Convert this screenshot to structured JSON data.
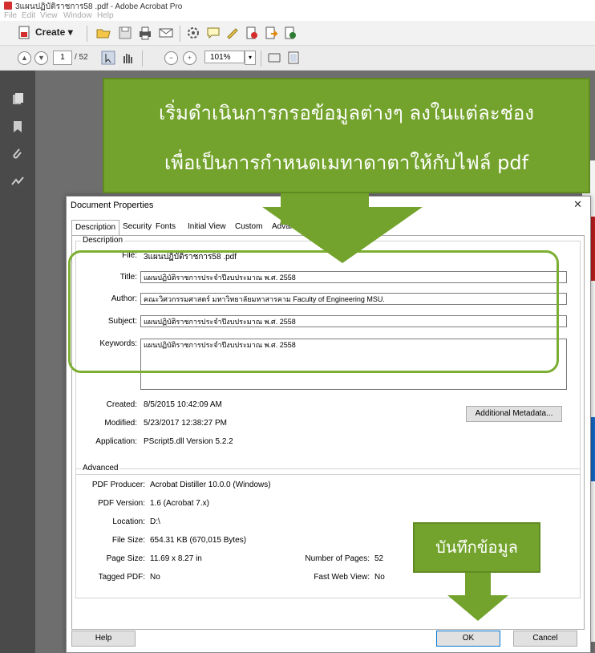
{
  "window": {
    "title": "3แผนปฏิบัติราชการ58 .pdf - Adobe Acrobat Pro"
  },
  "menu": [
    "File",
    "Edit",
    "View",
    "Window",
    "Help"
  ],
  "toolbar": {
    "create_label": "Create",
    "create_arrow": "▾"
  },
  "nav": {
    "page_current": "1",
    "page_total": "/ 52",
    "zoom": "101%",
    "zoom_arrow": "▾"
  },
  "callout": {
    "line1": "เริ่มดำเนินการกรอข้อมูลต่างๆ ลงในแต่ละช่อง",
    "line2": "เพื่อเป็นการกำหนดเมทาดาตาให้กับไฟล์ pdf",
    "save_label": "บันทึกข้อมูล",
    "color": "#73a32c"
  },
  "dialog": {
    "title": "Document Properties",
    "close_glyph": "✕",
    "tabs": [
      "Description",
      "Security",
      "Fonts",
      "Initial View",
      "Custom",
      "Advanced"
    ],
    "description": {
      "group_label": "Description",
      "file_label": "File:",
      "file_value": "3แผนปฏิบัติราชการ58 .pdf",
      "title_label": "Title:",
      "title_value": "แผนปฏิบัติราชการประจำปีงบประมาณ พ.ศ. 2558",
      "author_label": "Author:",
      "author_value": "คณะวิศวกรรมศาสตร์ มหาวิทยาลัยมหาสารคาม Faculty of Engineering MSU.",
      "subject_label": "Subject:",
      "subject_value": "แผนปฏิบัติราชการประจำปีงบประมาณ พ.ศ. 2558",
      "keywords_label": "Keywords:",
      "keywords_value": "แผนปฏิบัติราชการประจำปีงบประมาณ พ.ศ. 2558",
      "created_label": "Created:",
      "created_value": "8/5/2015 10:42:09 AM",
      "modified_label": "Modified:",
      "modified_value": "5/23/2017 12:38:27 PM",
      "application_label": "Application:",
      "application_value": "PScript5.dll Version 5.2.2",
      "additional_metadata_button": "Additional Metadata..."
    },
    "advanced": {
      "group_label": "Advanced",
      "producer_label": "PDF Producer:",
      "producer_value": "Acrobat Distiller 10.0.0 (Windows)",
      "version_label": "PDF Version:",
      "version_value": "1.6 (Acrobat 7.x)",
      "location_label": "Location:",
      "location_value": "D:\\",
      "filesize_label": "File Size:",
      "filesize_value": "654.31 KB (670,015 Bytes)",
      "pagesize_label": "Page Size:",
      "pagesize_value": "11.69 x 8.27 in",
      "numpages_label": "Number of Pages:",
      "numpages_value": "52",
      "tagged_label": "Tagged PDF:",
      "tagged_value": "No",
      "fastweb_label": "Fast Web View:",
      "fastweb_value": "No"
    },
    "buttons": {
      "help": "Help",
      "ok": "OK",
      "cancel": "Cancel"
    }
  }
}
